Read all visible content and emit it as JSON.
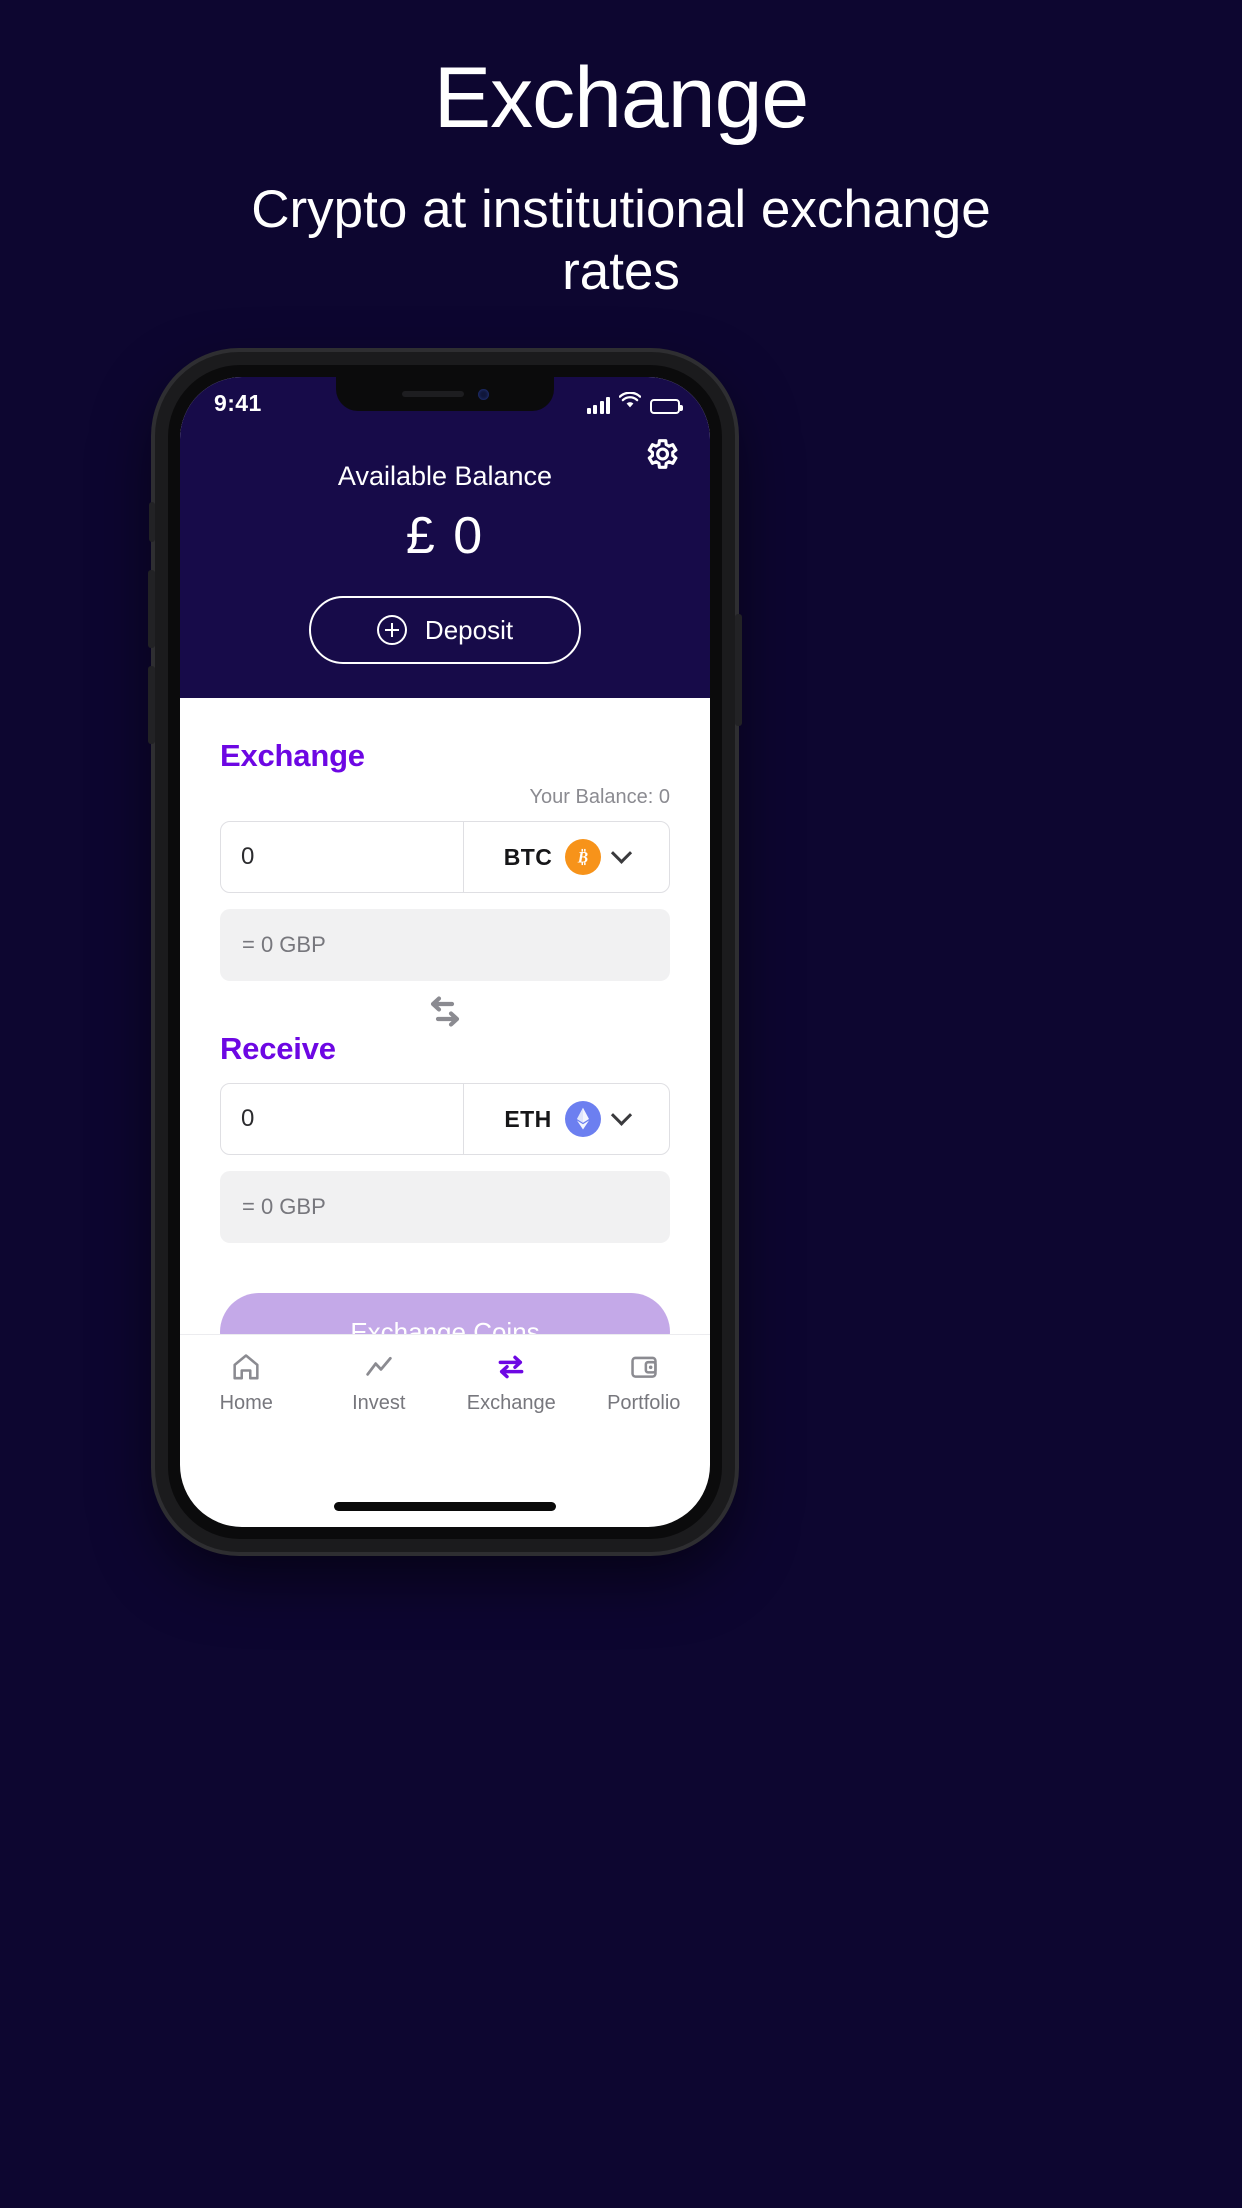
{
  "promo": {
    "title": "Exchange",
    "subtitle": "Crypto at institutional exchange rates"
  },
  "colors": {
    "page_background": "#0d0630",
    "app_header_background": "#170b49",
    "accent_purple": "#6d07e3",
    "cta_button": "#c4a9e8",
    "btc_orange": "#f7931a",
    "eth_blue": "#627eea",
    "muted_text": "#77777d"
  },
  "statusbar": {
    "time": "9:41",
    "icons": [
      "signal-icon",
      "wifi-icon",
      "battery-icon"
    ]
  },
  "header": {
    "settings_icon": "gear-icon",
    "balance_label": "Available Balance",
    "balance_amount": "£ 0",
    "deposit_label": "Deposit",
    "deposit_icon": "plus-circle-icon"
  },
  "exchange": {
    "section_title": "Exchange",
    "balance_note": "Your Balance: 0",
    "amount_value": "0",
    "amount_placeholder": "0",
    "coin_code": "BTC",
    "coin_icon": "bitcoin-icon",
    "chevron_icon": "chevron-down-icon",
    "converted": "= 0 GBP"
  },
  "swap": {
    "icon": "swap-arrows-icon"
  },
  "receive": {
    "section_title": "Receive",
    "amount_value": "0",
    "amount_placeholder": "0",
    "coin_code": "ETH",
    "coin_icon": "ethereum-icon",
    "chevron_icon": "chevron-down-icon",
    "converted": "= 0 GBP"
  },
  "cta": {
    "label": "Exchange Coins"
  },
  "tabbar": {
    "items": [
      {
        "label": "Home",
        "icon": "home-icon",
        "active": false
      },
      {
        "label": "Invest",
        "icon": "chart-line-icon",
        "active": false
      },
      {
        "label": "Exchange",
        "icon": "exchange-arrows-icon",
        "active": true
      },
      {
        "label": "Portfolio",
        "icon": "wallet-icon",
        "active": false
      }
    ]
  }
}
